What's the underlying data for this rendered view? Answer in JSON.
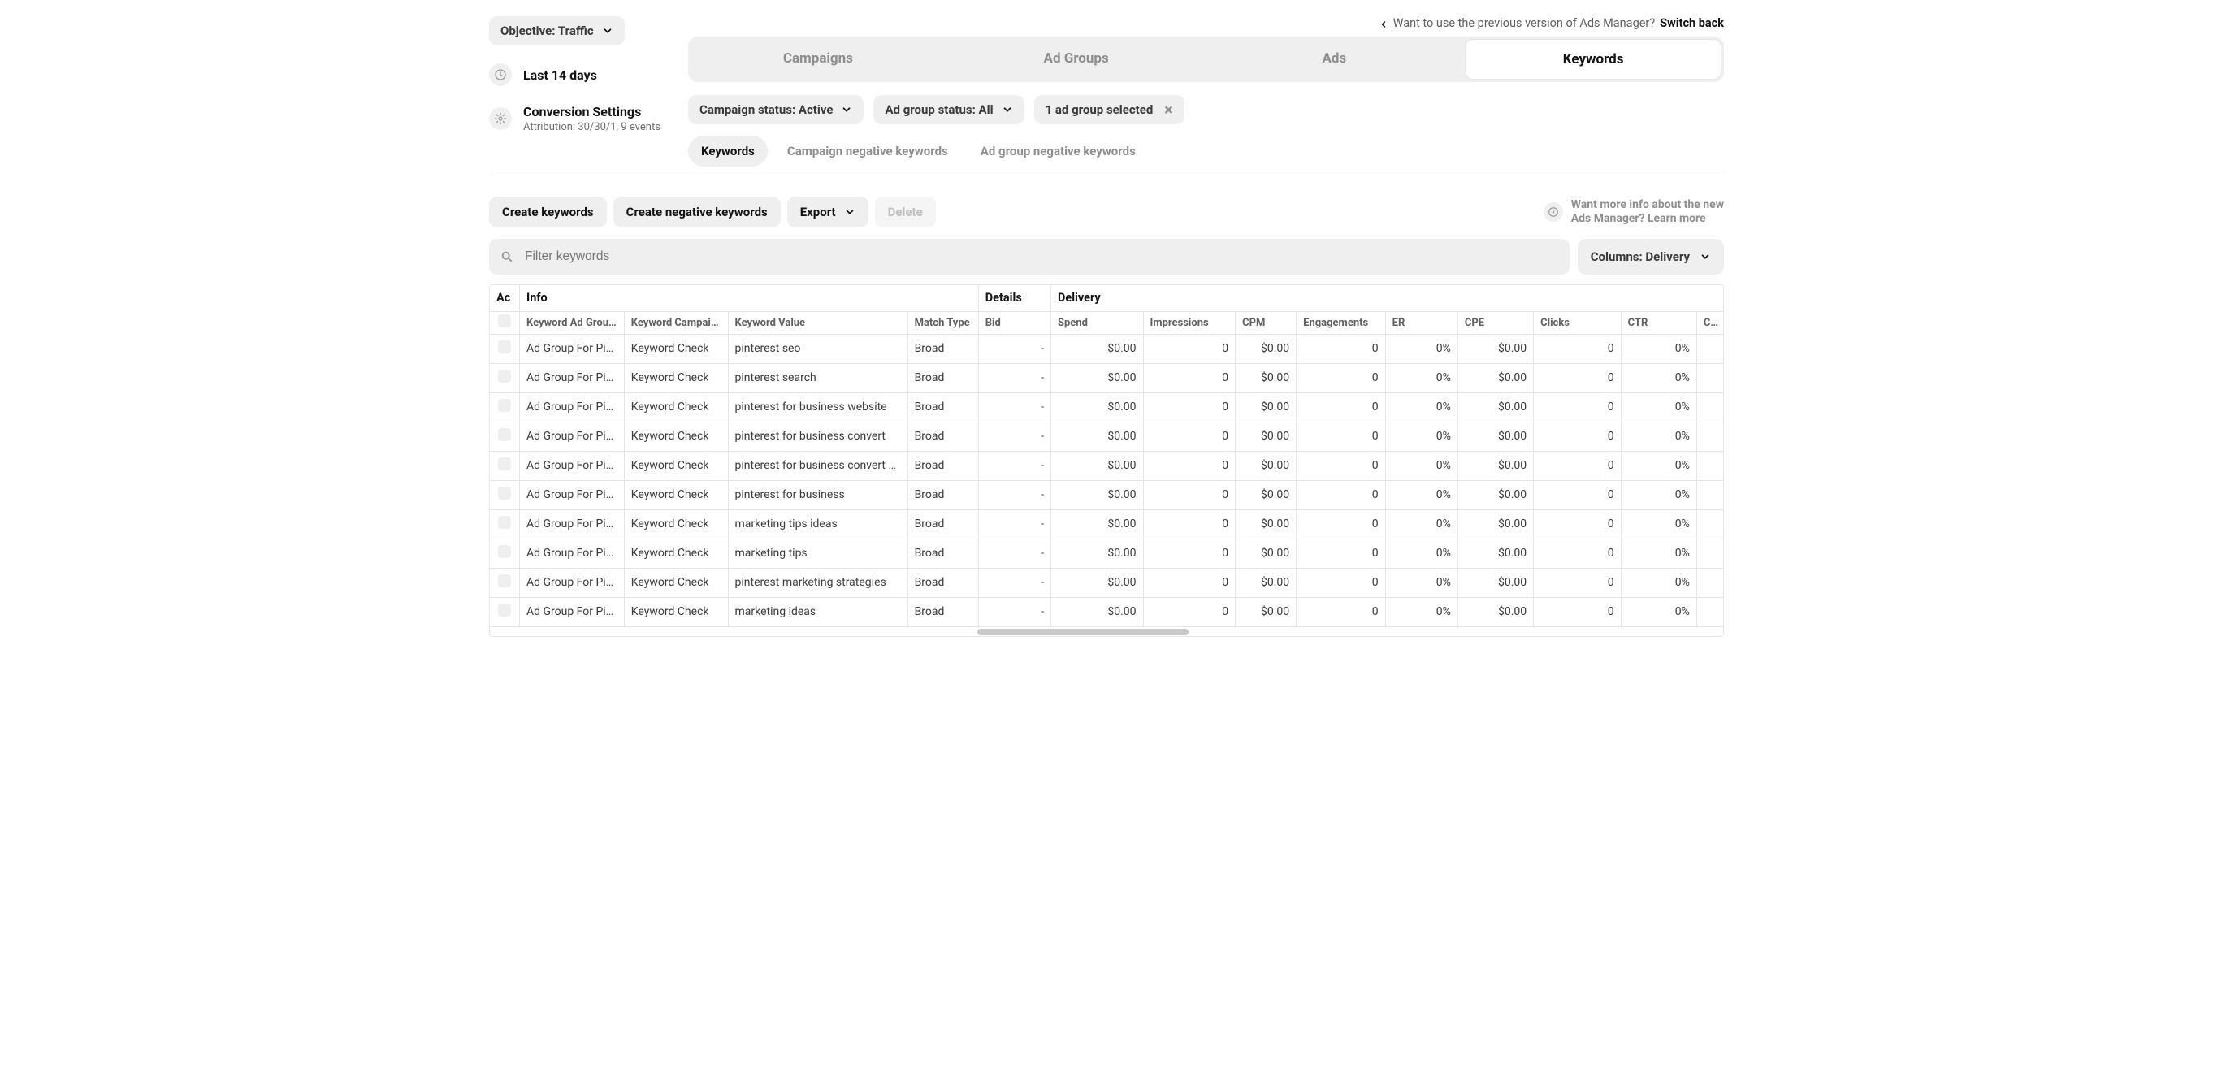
{
  "objective": {
    "label": "Objective: Traffic"
  },
  "sidebar": {
    "date_range": "Last 14 days",
    "conversion_title": "Conversion Settings",
    "conversion_sub": "Attribution: 30/30/1, 9 events"
  },
  "prev_link": {
    "question": "Want to use the previous version of Ads Manager?",
    "action": "Switch back"
  },
  "tabs": [
    "Campaigns",
    "Ad Groups",
    "Ads",
    "Keywords"
  ],
  "active_tab_index": 3,
  "filter_pills": {
    "campaign_status": "Campaign status: Active",
    "adgroup_status": "Ad group status: All",
    "selected": "1 ad group selected"
  },
  "subtabs": [
    "Keywords",
    "Campaign negative keywords",
    "Ad group negative keywords"
  ],
  "active_subtab_index": 0,
  "actions": {
    "create": "Create keywords",
    "create_neg": "Create negative keywords",
    "export": "Export",
    "delete": "Delete"
  },
  "info_hint": {
    "line1": "Want more info about the new",
    "line2": "Ads Manager? Learn more"
  },
  "search": {
    "placeholder": "Filter keywords"
  },
  "columns_btn": "Columns: Delivery",
  "table": {
    "groups": {
      "act_short": "Ac",
      "info": "Info",
      "details": "Details",
      "delivery": "Delivery"
    },
    "headers": {
      "adgroup": "Keyword Ad Group Na",
      "campaign": "Keyword Campaign Na",
      "value": "Keyword Value",
      "match": "Match Type",
      "bid": "Bid",
      "spend": "Spend",
      "impressions": "Impressions",
      "cpm": "CPM",
      "engagements": "Engagements",
      "er": "ER",
      "cpe": "CPE",
      "clicks": "Clicks",
      "ctr": "CTR",
      "cpc": "CP"
    },
    "rows": [
      {
        "adgroup": "Ad Group For Pin: Pi",
        "campaign": "Keyword Check",
        "value": "pinterest seo",
        "match": "Broad",
        "bid": "-",
        "spend": "$0.00",
        "impressions": "0",
        "cpm": "$0.00",
        "engagements": "0",
        "er": "0%",
        "cpe": "$0.00",
        "clicks": "0",
        "ctr": "0%"
      },
      {
        "adgroup": "Ad Group For Pin: Pi",
        "campaign": "Keyword Check",
        "value": "pinterest search",
        "match": "Broad",
        "bid": "-",
        "spend": "$0.00",
        "impressions": "0",
        "cpm": "$0.00",
        "engagements": "0",
        "er": "0%",
        "cpe": "$0.00",
        "clicks": "0",
        "ctr": "0%"
      },
      {
        "adgroup": "Ad Group For Pin: Pi",
        "campaign": "Keyword Check",
        "value": "pinterest for business website",
        "match": "Broad",
        "bid": "-",
        "spend": "$0.00",
        "impressions": "0",
        "cpm": "$0.00",
        "engagements": "0",
        "er": "0%",
        "cpe": "$0.00",
        "clicks": "0",
        "ctr": "0%"
      },
      {
        "adgroup": "Ad Group For Pin: Pi",
        "campaign": "Keyword Check",
        "value": "pinterest for business convert",
        "match": "Broad",
        "bid": "-",
        "spend": "$0.00",
        "impressions": "0",
        "cpm": "$0.00",
        "engagements": "0",
        "er": "0%",
        "cpe": "$0.00",
        "clicks": "0",
        "ctr": "0%"
      },
      {
        "adgroup": "Ad Group For Pin: Pi",
        "campaign": "Keyword Check",
        "value": "pinterest for business convert how to",
        "match": "Broad",
        "bid": "-",
        "spend": "$0.00",
        "impressions": "0",
        "cpm": "$0.00",
        "engagements": "0",
        "er": "0%",
        "cpe": "$0.00",
        "clicks": "0",
        "ctr": "0%"
      },
      {
        "adgroup": "Ad Group For Pin: Pi",
        "campaign": "Keyword Check",
        "value": "pinterest for business",
        "match": "Broad",
        "bid": "-",
        "spend": "$0.00",
        "impressions": "0",
        "cpm": "$0.00",
        "engagements": "0",
        "er": "0%",
        "cpe": "$0.00",
        "clicks": "0",
        "ctr": "0%"
      },
      {
        "adgroup": "Ad Group For Pin: Pi",
        "campaign": "Keyword Check",
        "value": "marketing tips ideas",
        "match": "Broad",
        "bid": "-",
        "spend": "$0.00",
        "impressions": "0",
        "cpm": "$0.00",
        "engagements": "0",
        "er": "0%",
        "cpe": "$0.00",
        "clicks": "0",
        "ctr": "0%"
      },
      {
        "adgroup": "Ad Group For Pin: Pi",
        "campaign": "Keyword Check",
        "value": "marketing tips",
        "match": "Broad",
        "bid": "-",
        "spend": "$0.00",
        "impressions": "0",
        "cpm": "$0.00",
        "engagements": "0",
        "er": "0%",
        "cpe": "$0.00",
        "clicks": "0",
        "ctr": "0%"
      },
      {
        "adgroup": "Ad Group For Pin: Pi",
        "campaign": "Keyword Check",
        "value": "pinterest marketing strategies",
        "match": "Broad",
        "bid": "-",
        "spend": "$0.00",
        "impressions": "0",
        "cpm": "$0.00",
        "engagements": "0",
        "er": "0%",
        "cpe": "$0.00",
        "clicks": "0",
        "ctr": "0%"
      },
      {
        "adgroup": "Ad Group For Pin: Pi",
        "campaign": "Keyword Check",
        "value": "marketing ideas",
        "match": "Broad",
        "bid": "-",
        "spend": "$0.00",
        "impressions": "0",
        "cpm": "$0.00",
        "engagements": "0",
        "er": "0%",
        "cpe": "$0.00",
        "clicks": "0",
        "ctr": "0%"
      }
    ]
  }
}
